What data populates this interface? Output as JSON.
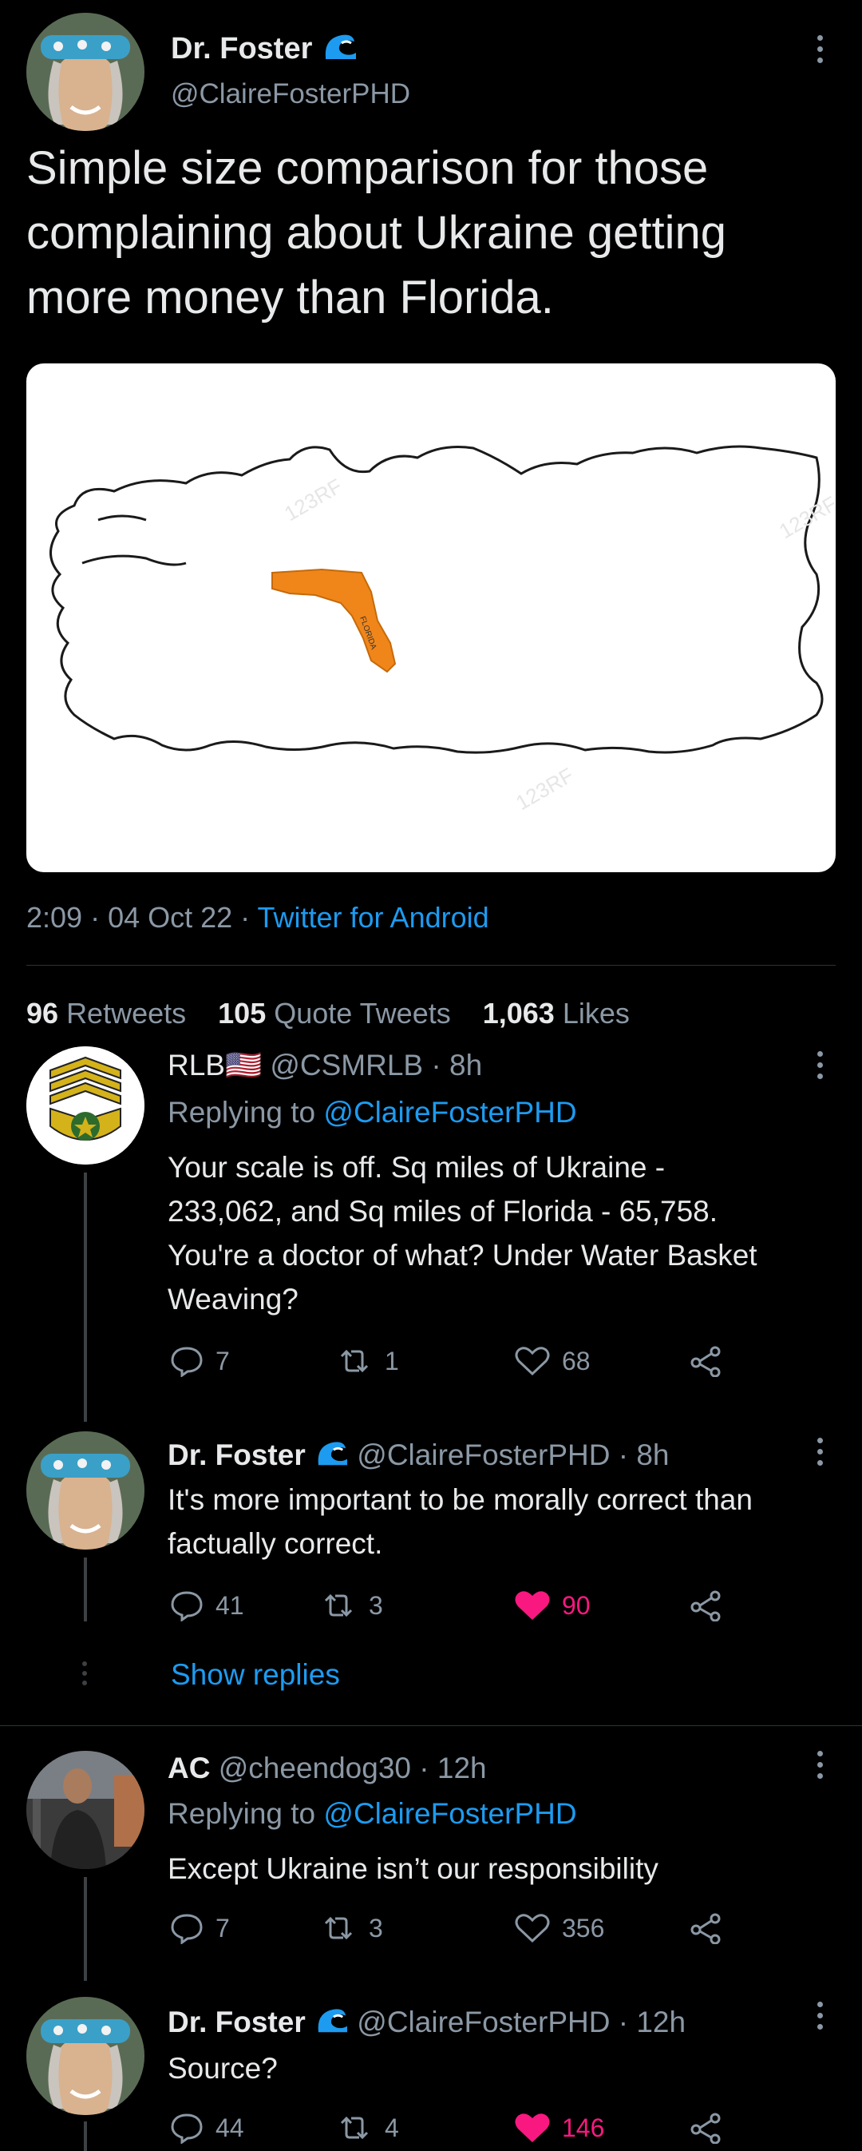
{
  "main_tweet": {
    "display_name": "Dr. Foster",
    "handle": "@ClaireFosterPHD",
    "text_lines": [
      "Simple size comparison for those",
      "complaining about Ukraine getting",
      "more money than Florida."
    ],
    "image": {
      "state_label": "FLORIDA",
      "watermark": "123RF"
    },
    "time": "2:09",
    "date": "04 Oct 22",
    "source": "Twitter for Android",
    "retweets_count": "96",
    "retweets_label": "Retweets",
    "quotes_count": "105",
    "quotes_label": "Quote Tweets",
    "likes_count": "1,063",
    "likes_label": "Likes"
  },
  "replies": [
    {
      "display_name": "RLB",
      "flag": "🇺🇸",
      "handle": "@CSMRLB",
      "time": "· 8h",
      "replying_prefix": "Replying to",
      "replying_to": "@ClaireFosterPHD",
      "text_lines": [
        "Your scale is off. Sq miles of Ukraine -",
        "233,062, and Sq miles of Florida - 65,758.",
        "You're a doctor of what? Under Water Basket",
        "Weaving?"
      ],
      "reply_count": "7",
      "retweet_count": "1",
      "like_count": "68"
    },
    {
      "display_name": "Dr. Foster",
      "handle": "@ClaireFosterPHD",
      "time": "· 8h",
      "text_lines": [
        "It's more important to be morally correct than",
        "factually correct."
      ],
      "reply_count": "41",
      "retweet_count": "3",
      "like_count": "90",
      "show_replies": "Show replies"
    },
    {
      "display_name": "AC",
      "handle": "@cheendog30",
      "time": "· 12h",
      "replying_prefix": "Replying to",
      "replying_to": "@ClaireFosterPHD",
      "text_lines": [
        "Except Ukraine isn’t our responsibility"
      ],
      "reply_count": "7",
      "retweet_count": "3",
      "like_count": "356"
    },
    {
      "display_name": "Dr. Foster",
      "handle": "@ClaireFosterPHD",
      "time": "· 12h",
      "text_lines": [
        "Source?"
      ],
      "reply_count": "44",
      "retweet_count": "4",
      "like_count": "146"
    }
  ],
  "colors": {
    "background": "#000000",
    "link_blue": "#1d9bf0",
    "like_pink": "#f91880",
    "florida_orange": "#f0861a",
    "muted_text": "#8b98a5"
  },
  "icons": [
    "wave-icon",
    "more-icon",
    "reply-icon",
    "retweet-icon",
    "like-icon",
    "share-icon"
  ]
}
